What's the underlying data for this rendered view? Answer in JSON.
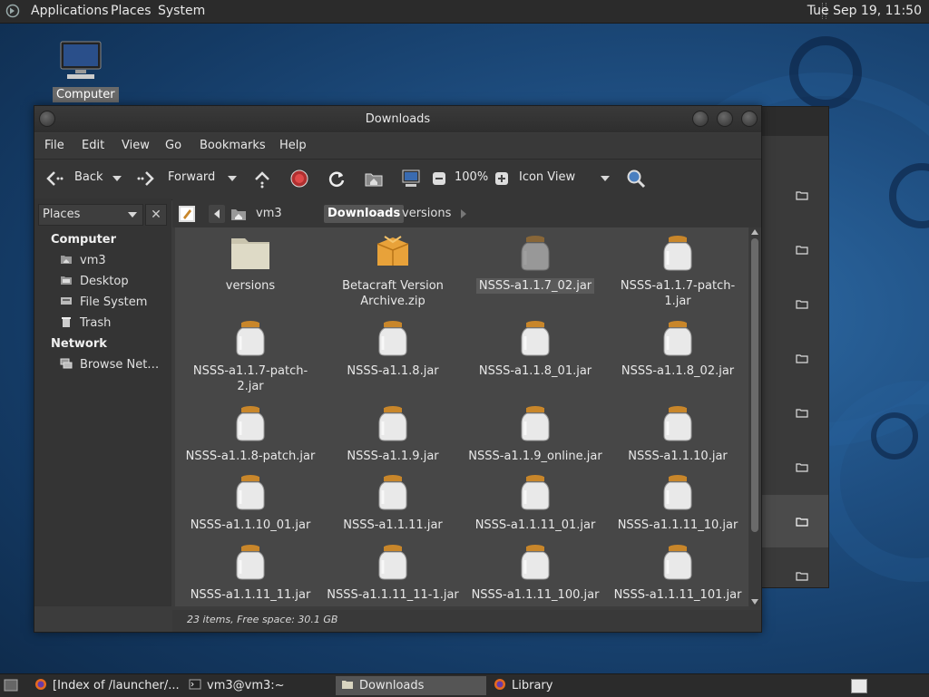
{
  "top_panel": {
    "menus": [
      "Applications",
      "Places",
      "System"
    ],
    "clock": "Tue Sep 19, 11:50"
  },
  "desktop": {
    "icon_label": "Computer"
  },
  "window": {
    "title": "Downloads",
    "menubar": [
      "File",
      "Edit",
      "View",
      "Go",
      "Bookmarks",
      "Help"
    ],
    "toolbar": {
      "back": "Back",
      "forward": "Forward",
      "zoom": "100%",
      "view_mode": "Icon View"
    },
    "sidebar": {
      "selector": "Places",
      "close": "✕",
      "headers": [
        "Computer",
        "Network"
      ],
      "items": [
        "vm3",
        "Desktop",
        "File System",
        "Trash",
        "Browse Net…"
      ]
    },
    "path": [
      "vm3",
      "Downloads",
      "versions"
    ],
    "files": [
      {
        "name": "versions",
        "type": "folder"
      },
      {
        "name": "Betacraft Version Archive.zip",
        "type": "zip"
      },
      {
        "name": "NSSS-a1.1.7_02.jar",
        "type": "jar",
        "selected": true
      },
      {
        "name": "NSSS-a1.1.7-patch-1.jar",
        "type": "jar"
      },
      {
        "name": "NSSS-a1.1.7-patch-2.jar",
        "type": "jar"
      },
      {
        "name": "NSSS-a1.1.8.jar",
        "type": "jar"
      },
      {
        "name": "NSSS-a1.1.8_01.jar",
        "type": "jar"
      },
      {
        "name": "NSSS-a1.1.8_02.jar",
        "type": "jar"
      },
      {
        "name": "NSSS-a1.1.8-patch.jar",
        "type": "jar"
      },
      {
        "name": "NSSS-a1.1.9.jar",
        "type": "jar"
      },
      {
        "name": "NSSS-a1.1.9_online.jar",
        "type": "jar"
      },
      {
        "name": "NSSS-a1.1.10.jar",
        "type": "jar"
      },
      {
        "name": "NSSS-a1.1.10_01.jar",
        "type": "jar"
      },
      {
        "name": "NSSS-a1.1.11.jar",
        "type": "jar"
      },
      {
        "name": "NSSS-a1.1.11_01.jar",
        "type": "jar"
      },
      {
        "name": "NSSS-a1.1.11_10.jar",
        "type": "jar"
      },
      {
        "name": "NSSS-a1.1.11_11.jar",
        "type": "jar"
      },
      {
        "name": "NSSS-a1.1.11_11-1.jar",
        "type": "jar"
      },
      {
        "name": "NSSS-a1.1.11_100.jar",
        "type": "jar"
      },
      {
        "name": "NSSS-a1.1.11_101.jar",
        "type": "jar"
      }
    ],
    "status": "23 items, Free space: 30.1 GB"
  },
  "taskbar": {
    "tasks": [
      "[Index of /launcher/...",
      "vm3@vm3:~",
      "Downloads",
      "Library"
    ],
    "active": "Downloads"
  },
  "colors": {
    "panel": "#2b2b2b",
    "window_bg": "#3c3c3c",
    "view_bg": "#474747",
    "jar_lid": "#c8862a",
    "folder": "#d8d4c0"
  }
}
